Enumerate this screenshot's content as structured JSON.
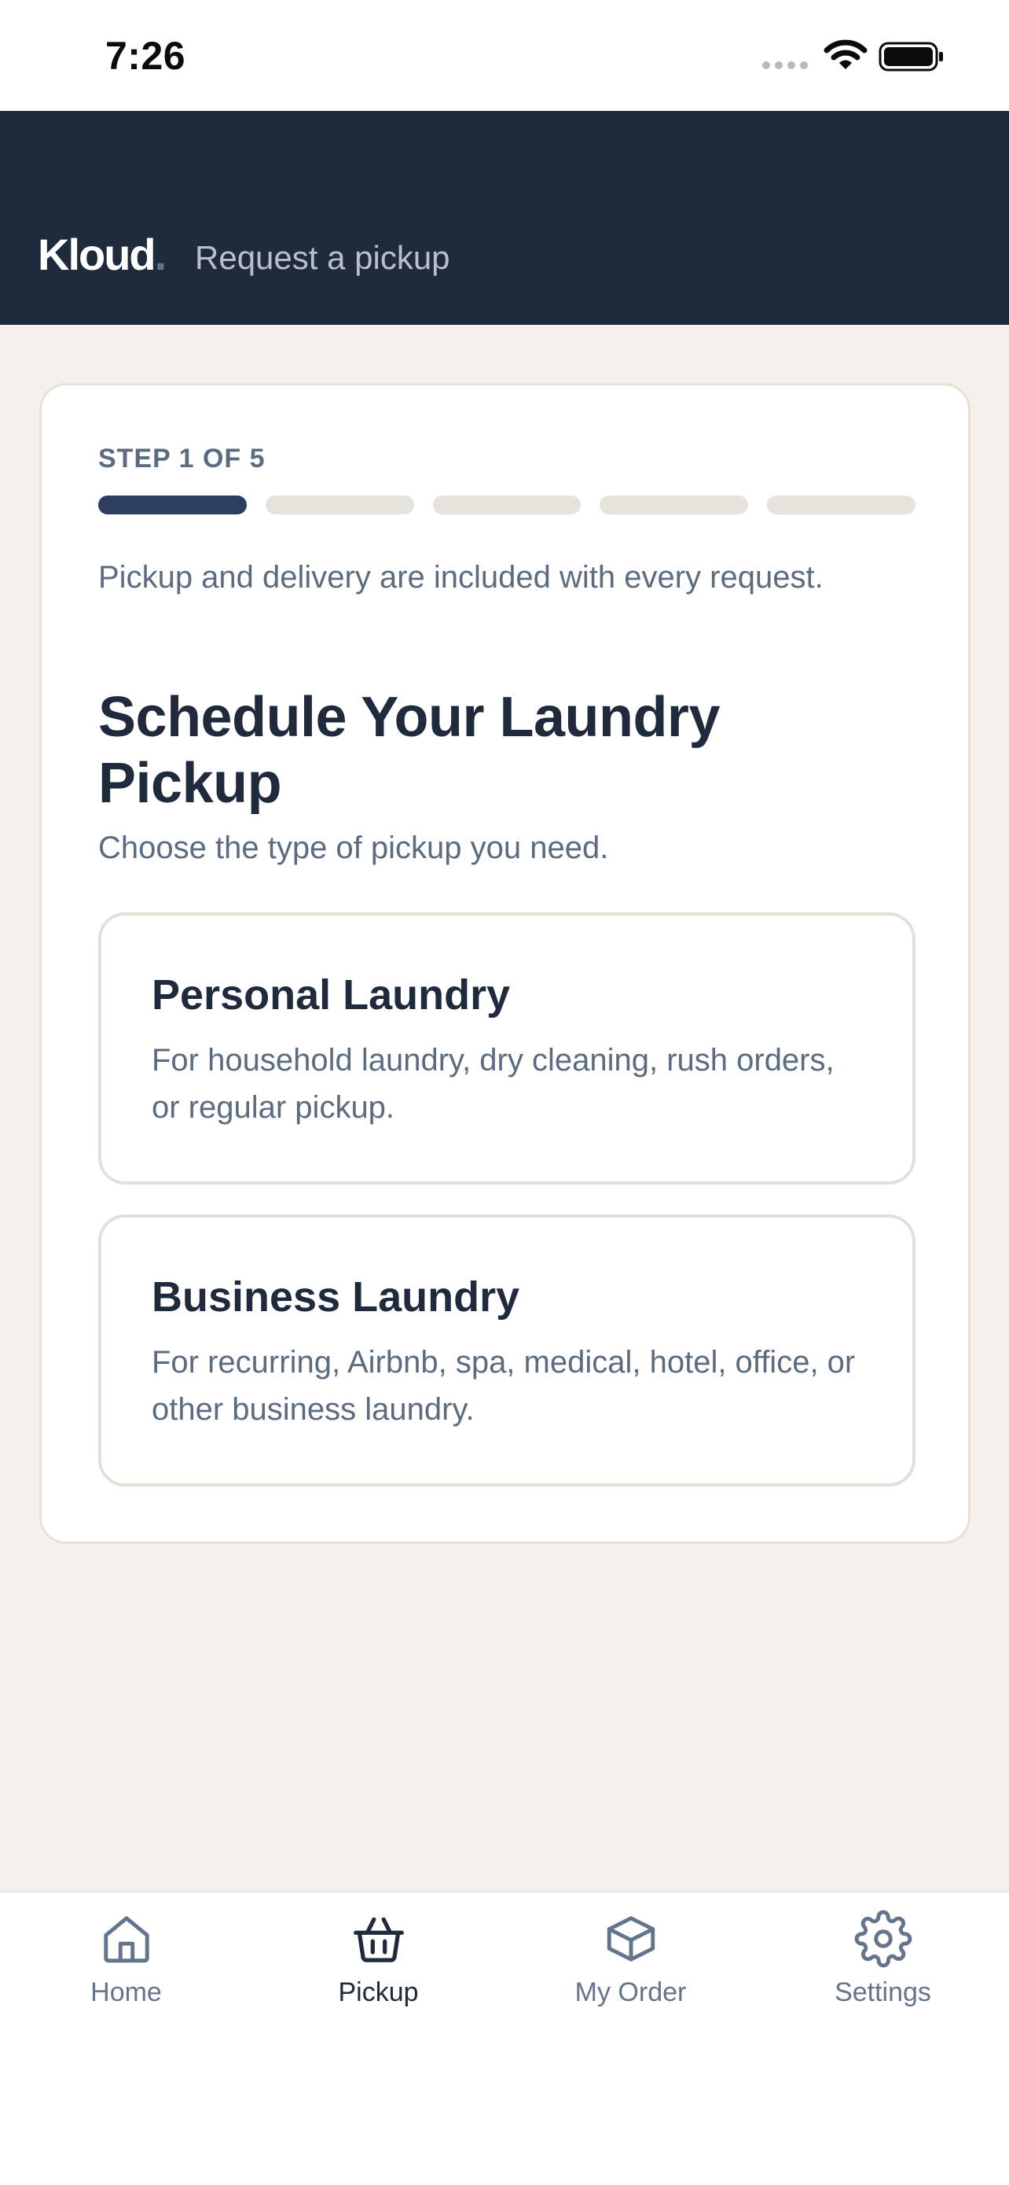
{
  "status_bar": {
    "time": "7:26"
  },
  "header": {
    "brand": "Kloud",
    "brand_dot": ".",
    "subtitle": "Request a pickup"
  },
  "card": {
    "step_label": "STEP 1 OF 5",
    "progress": {
      "current": 1,
      "total": 5
    },
    "info_text": "Pickup and delivery are included with every request.",
    "title": "Schedule Your Laundry Pickup",
    "subtitle": "Choose the type of pickup you need.",
    "options": [
      {
        "title": "Personal Laundry",
        "description": "For household laundry, dry cleaning, rush orders, or regular pickup."
      },
      {
        "title": "Business Laundry",
        "description": "For recurring, Airbnb, spa, medical, hotel, office, or other business laundry."
      }
    ]
  },
  "nav": {
    "items": [
      {
        "label": "Home",
        "icon": "home-icon"
      },
      {
        "label": "Pickup",
        "icon": "basket-icon",
        "active": true
      },
      {
        "label": "My Order",
        "icon": "box-icon"
      },
      {
        "label": "Settings",
        "icon": "gear-icon"
      }
    ]
  },
  "colors": {
    "header_bg": "#1f2a3d",
    "page_bg": "#f4f1ec",
    "progress_active": "#2c3e5e",
    "progress_inactive": "#e6e3dc",
    "text_primary": "#1f2a3d",
    "text_muted": "#5b6b80"
  }
}
